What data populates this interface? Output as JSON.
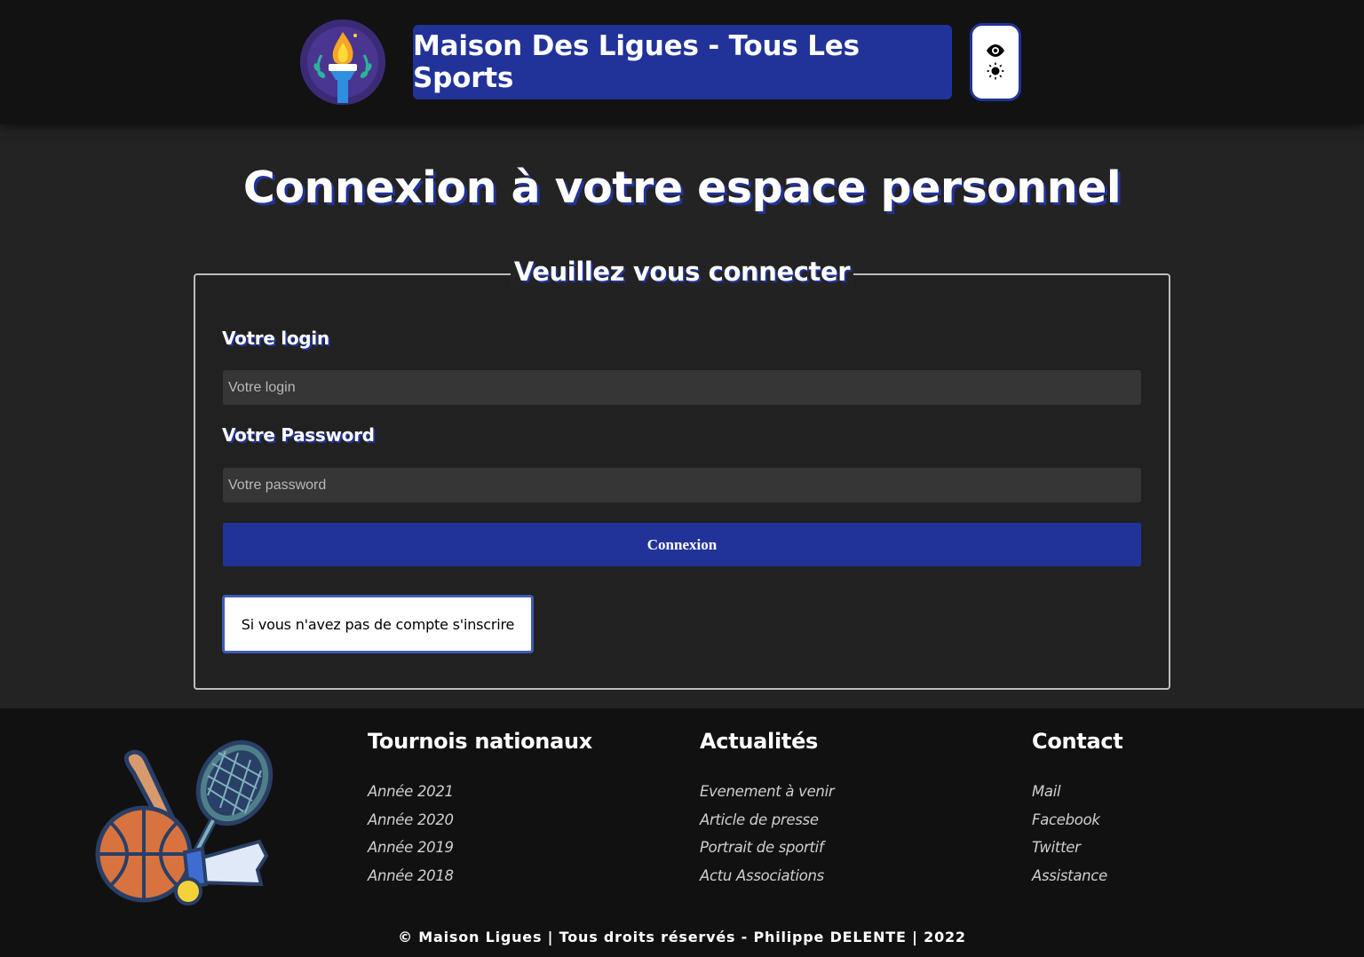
{
  "header": {
    "logo_alt": "torch-logo",
    "site_title": "Maison Des Ligues - Tous Les Sports",
    "accessibility": {
      "icons": [
        "eye-icon",
        "sun-icon"
      ]
    }
  },
  "page_title": "Connexion à votre espace personnel",
  "form": {
    "legend": "Veuillez vous connecter",
    "login_label": "Votre login",
    "login_placeholder": "Votre login",
    "password_label": "Votre Password",
    "password_placeholder": "Votre password",
    "submit_label": "Connexion",
    "register_label": "Si vous n'avez pas de compte s'inscrire"
  },
  "footer": {
    "columns": [
      {
        "title": "Tournois nationaux",
        "links": [
          "Année 2021",
          "Année 2020",
          "Année 2019",
          "Année 2018"
        ]
      },
      {
        "title": "Actualités",
        "links": [
          "Evenement à venir",
          "Article de presse",
          "Portrait de sportif",
          "Actu Associations"
        ]
      },
      {
        "title": "Contact",
        "links": [
          "Mail",
          "Facebook",
          "Twitter",
          "Assistance"
        ]
      }
    ],
    "copyright": "© Maison Ligues | Tous droits réservés - Philippe DELENTE | 2022"
  },
  "colors": {
    "accent": "#213399",
    "header_bg": "#121212",
    "body_bg": "#232323",
    "footer_bg": "#111111"
  }
}
